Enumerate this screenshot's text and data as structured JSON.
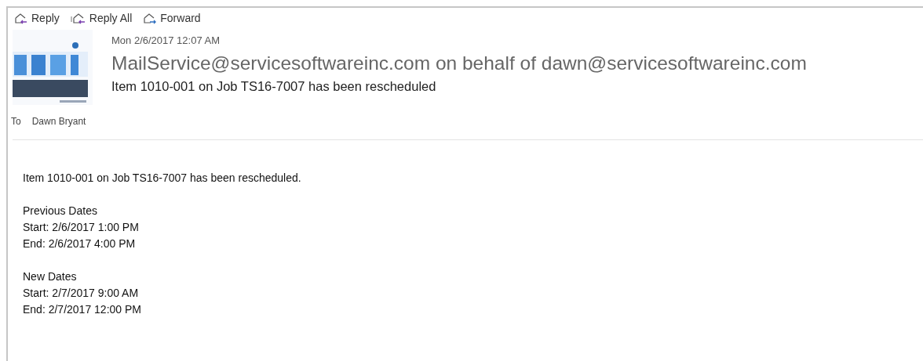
{
  "toolbar": [
    {
      "label": "Reply",
      "kind": "reply"
    },
    {
      "label": "Reply All",
      "kind": "reply_all"
    },
    {
      "label": "Forward",
      "kind": "forward"
    }
  ],
  "header": {
    "date": "Mon 2/6/2017 12:07 AM",
    "sender": "MailService@servicesoftwareinc.com on behalf of dawn@servicesoftwareinc.com",
    "subject": "Item 1010-001 on Job TS16-7007 has been rescheduled",
    "to_label": "To",
    "to": "Dawn Bryant"
  },
  "body": [
    [
      "Item 1010-001 on Job TS16-7007 has been rescheduled."
    ],
    [
      "Previous Dates",
      "Start: 2/6/2017 1:00 PM",
      "End: 2/6/2017 4:00 PM"
    ],
    [
      "New Dates",
      "Start: 2/7/2017 9:00 AM",
      "End: 2/7/2017 12:00 PM"
    ]
  ]
}
